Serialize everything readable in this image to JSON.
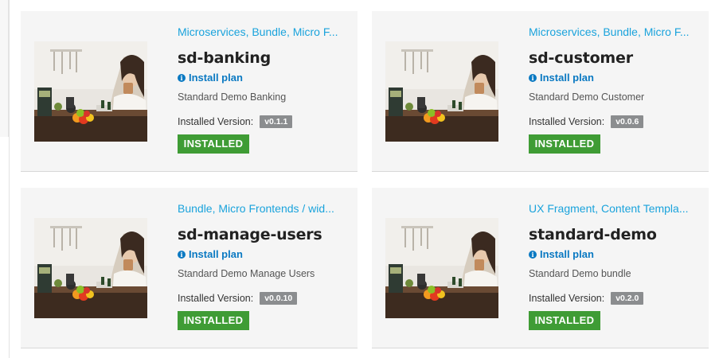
{
  "cards": [
    {
      "tags": "Microservices, Bundle, Micro F...",
      "name": "sd-banking",
      "install_plan": "Install plan",
      "description": "Standard Demo Banking",
      "installed_version_label": "Installed Version:",
      "version": "v0.1.1",
      "status": "INSTALLED"
    },
    {
      "tags": "Microservices, Bundle, Micro F...",
      "name": "sd-customer",
      "install_plan": "Install plan",
      "description": "Standard Demo Customer",
      "installed_version_label": "Installed Version:",
      "version": "v0.0.6",
      "status": "INSTALLED"
    },
    {
      "tags": "Bundle, Micro Frontends / wid...",
      "name": "sd-manage-users",
      "install_plan": "Install plan",
      "description": "Standard Demo Manage Users",
      "installed_version_label": "Installed Version:",
      "version": "v0.0.10",
      "status": "INSTALLED"
    },
    {
      "tags": "UX Fragment, Content Templa...",
      "name": "standard-demo",
      "install_plan": "Install plan",
      "description": "Standard Demo bundle",
      "installed_version_label": "Installed Version:",
      "version": "v0.2.0",
      "status": "INSTALLED"
    }
  ],
  "colors": {
    "tag_link": "#1aa3dc",
    "plan_link": "#0a79c2",
    "installed": "#3f9c35",
    "version_badge": "#8b8d8f",
    "card_bg": "#f5f5f5"
  },
  "icons": {
    "install_plan": "info-circle-icon"
  }
}
